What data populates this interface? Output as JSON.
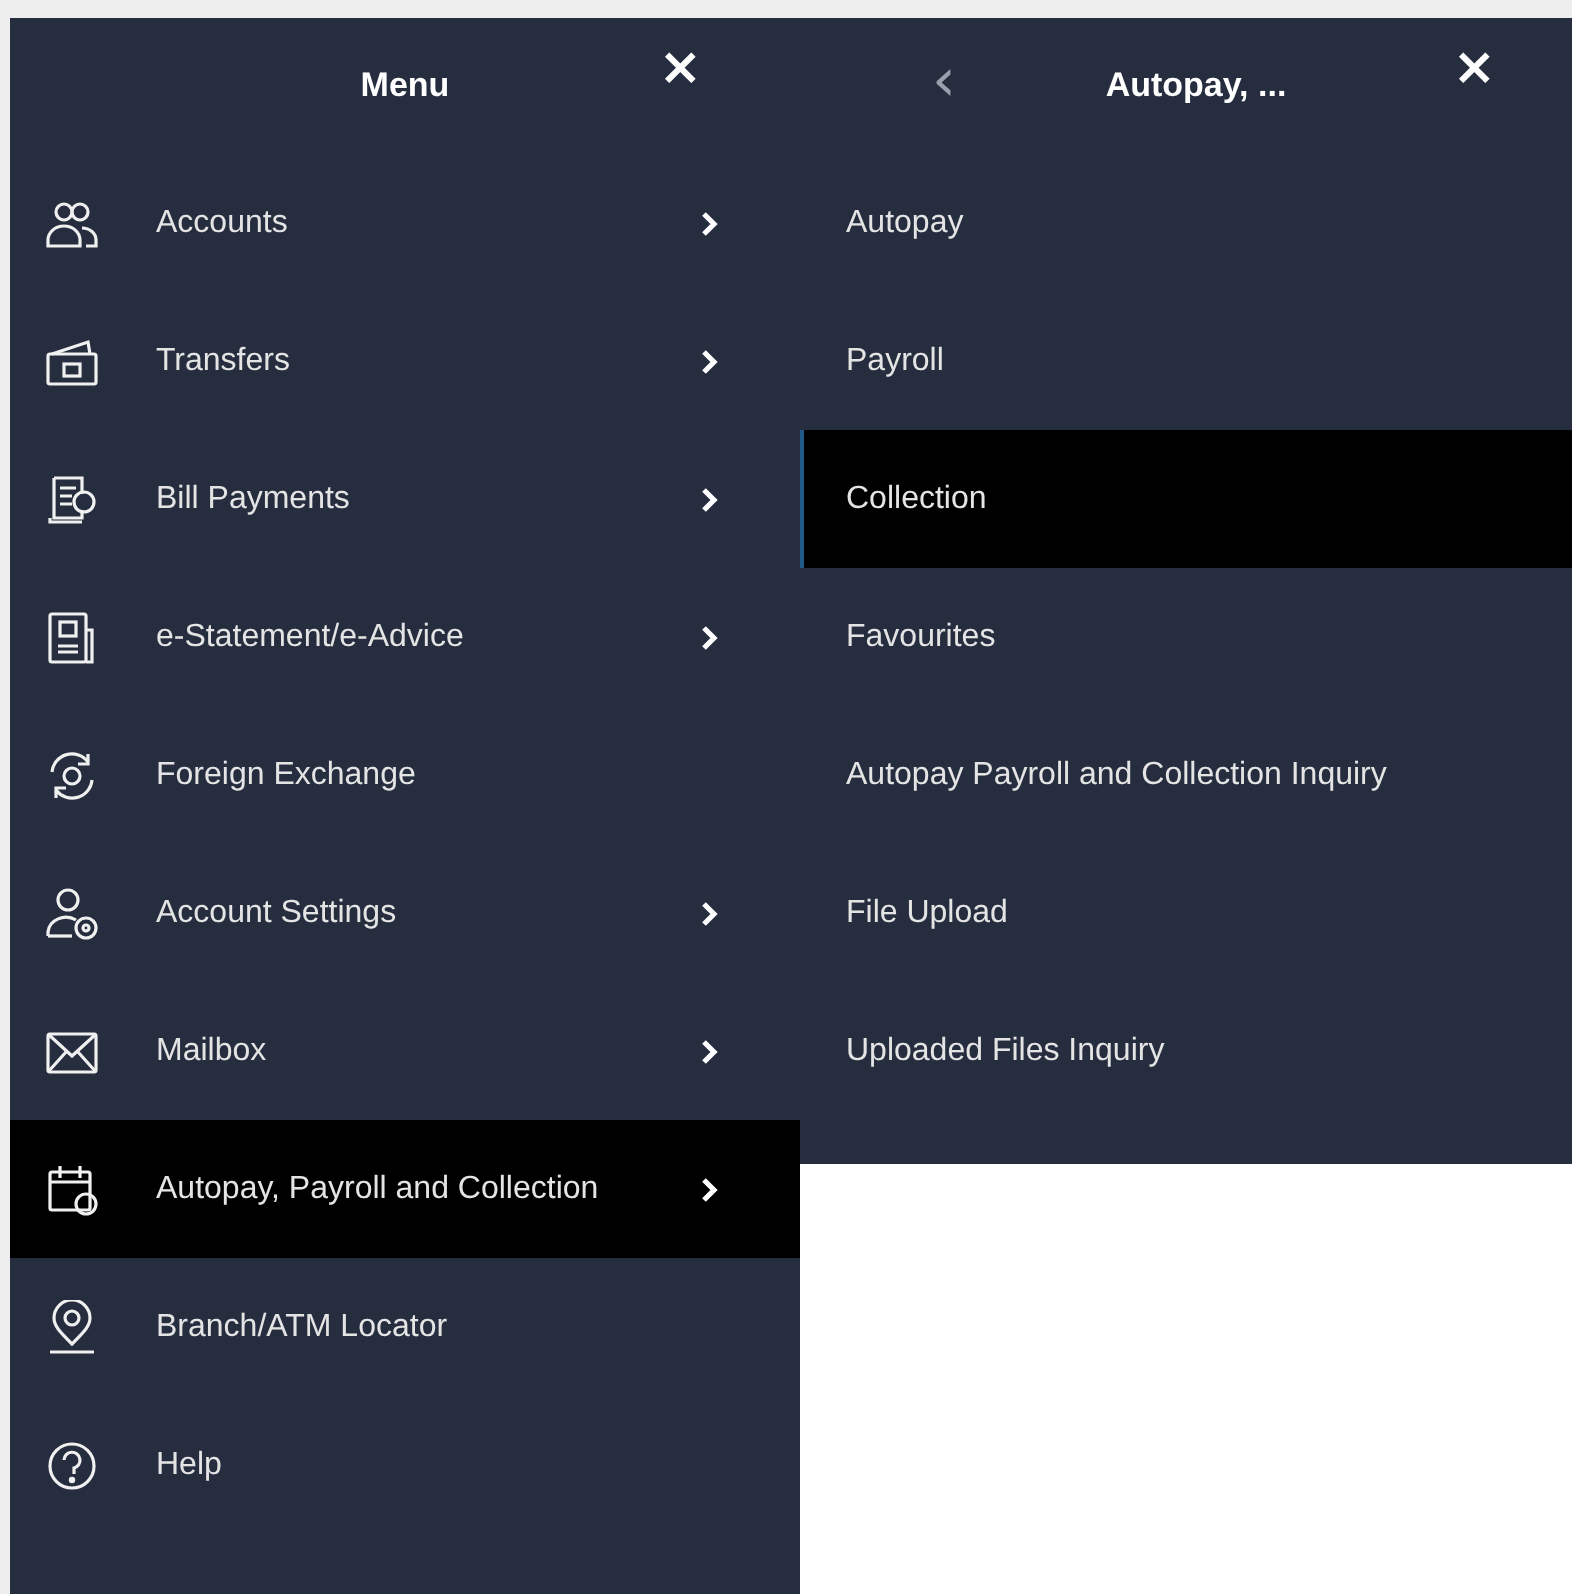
{
  "main_menu": {
    "title": "Menu",
    "close": "×",
    "items": [
      {
        "label": "Accounts",
        "has_submenu": true,
        "selected": false
      },
      {
        "label": "Transfers",
        "has_submenu": true,
        "selected": false
      },
      {
        "label": "Bill Payments",
        "has_submenu": true,
        "selected": false
      },
      {
        "label": "e-Statement/e-Advice",
        "has_submenu": true,
        "selected": false
      },
      {
        "label": "Foreign Exchange",
        "has_submenu": false,
        "selected": false
      },
      {
        "label": "Account Settings",
        "has_submenu": true,
        "selected": false
      },
      {
        "label": "Mailbox",
        "has_submenu": true,
        "selected": false
      },
      {
        "label": "Autopay, Payroll and Collection",
        "has_submenu": true,
        "selected": true
      },
      {
        "label": "Branch/ATM Locator",
        "has_submenu": false,
        "selected": false
      },
      {
        "label": "Help",
        "has_submenu": false,
        "selected": false
      }
    ]
  },
  "submenu": {
    "back": "‹",
    "title": "Autopay, ...",
    "close": "×",
    "items": [
      {
        "label": "Autopay",
        "selected": false
      },
      {
        "label": "Payroll",
        "selected": false
      },
      {
        "label": "Collection",
        "selected": true
      },
      {
        "label": "Favourites",
        "selected": false
      },
      {
        "label": "Autopay Payroll and Collection Inquiry",
        "selected": false
      },
      {
        "label": "File Upload",
        "selected": false
      },
      {
        "label": "Uploaded Files Inquiry",
        "selected": false
      }
    ]
  }
}
